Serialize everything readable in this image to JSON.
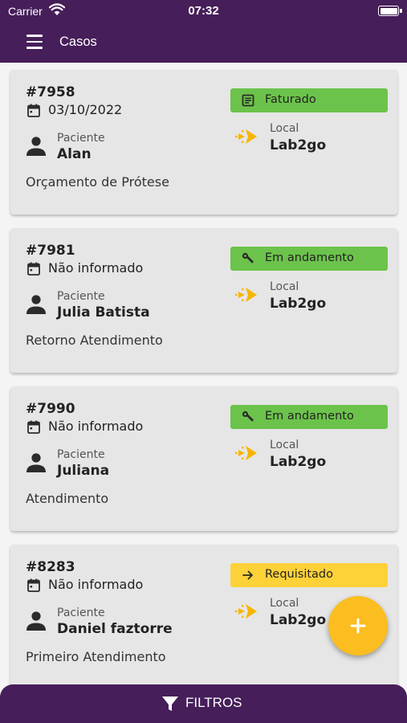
{
  "status_bar": {
    "carrier": "Carrier",
    "time": "07:32"
  },
  "header": {
    "title": "Casos"
  },
  "cards": [
    {
      "id": "#7958",
      "date": "03/10/2022",
      "patient_label": "Paciente",
      "patient": "Alan",
      "description": "Orçamento de Prótese",
      "status": "Faturado",
      "status_icon": "receipt-icon",
      "status_color": "#6cc34b",
      "local_label": "Local",
      "local": "Lab2go"
    },
    {
      "id": "#7981",
      "date": "Não informado",
      "patient_label": "Paciente",
      "patient": "Julia Batista",
      "description": "Retorno Atendimento",
      "status": "Em andamento",
      "status_icon": "wrench-icon",
      "status_color": "#6cc34b",
      "local_label": "Local",
      "local": "Lab2go"
    },
    {
      "id": "#7990",
      "date": "Não informado",
      "patient_label": "Paciente",
      "patient": "Juliana",
      "description": "Atendimento",
      "status": "Em andamento",
      "status_icon": "wrench-icon",
      "status_color": "#6cc34b",
      "local_label": "Local",
      "local": "Lab2go"
    },
    {
      "id": "#8283",
      "date": "Não informado",
      "patient_label": "Paciente",
      "patient": "Daniel faztorre",
      "description": "Primeiro Atendimento",
      "status": "Requisitado",
      "status_icon": "arrow-right-icon",
      "status_color": "#fdd138",
      "local_label": "Local",
      "local": "Lab2go"
    }
  ],
  "fab": {
    "icon": "plus-icon"
  },
  "bottom_bar": {
    "label": "FILTROS",
    "icon": "filter-icon"
  },
  "colors": {
    "brand_purple": "#461e5a",
    "accent_yellow": "#fbbd1f",
    "logo_yellow": "#f7b500",
    "status_green": "#6cc34b",
    "status_yellow": "#fdd138"
  }
}
